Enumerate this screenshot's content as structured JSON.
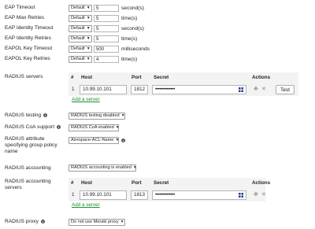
{
  "eap": {
    "rows": [
      {
        "label": "EAP Timeout",
        "mode": "Default",
        "value": "5",
        "unit": "second(s)"
      },
      {
        "label": "EAP Max Retries",
        "mode": "Default",
        "value": "5",
        "unit": "time(s)"
      },
      {
        "label": "EAP Identity Timeout",
        "mode": "Default",
        "value": "5",
        "unit": "second(s)"
      },
      {
        "label": "EAP Identity Retries",
        "mode": "Default",
        "value": "5",
        "unit": "time(s)"
      },
      {
        "label": "EAPOL Key Timeout",
        "mode": "Default",
        "value": "500",
        "unit": "milliseconds"
      },
      {
        "label": "EAPOL Key Retries",
        "mode": "Default",
        "value": "4",
        "unit": "time(s)"
      }
    ]
  },
  "radius_servers": {
    "label": "RADIUS servers",
    "headers": {
      "num": "#",
      "host": "Host",
      "port": "Port",
      "secret": "Secret",
      "actions": "Actions"
    },
    "row": {
      "index": "1",
      "host": "10.99.10.101",
      "port": "1812",
      "secret": "••••••••••••••"
    },
    "test_label": "Test",
    "add_label": "Add a server"
  },
  "radius_testing": {
    "label": "RADIUS testing",
    "value": "RADIUS testing disabled"
  },
  "radius_coa": {
    "label": "RADIUS CoA support",
    "value": "RADIUS CoA enabled"
  },
  "radius_group_policy": {
    "label_lines": [
      "RADIUS attribute",
      "specifying group policy",
      "name"
    ],
    "value": "Airespace-ACL-Name"
  },
  "radius_accounting": {
    "label": "RADIUS accounting",
    "value": "RADIUS accounting is enabled"
  },
  "radius_accounting_servers": {
    "label_lines": [
      "RADIUS accounting",
      "servers"
    ],
    "headers": {
      "num": "#",
      "host": "Host",
      "port": "Port",
      "secret": "Secret",
      "actions": "Actions"
    },
    "row": {
      "index": "1",
      "host": "10.99.10.101",
      "port": "1813",
      "secret": "••••••••••••••"
    },
    "add_label": "Add a server"
  },
  "radius_proxy": {
    "label": "RADIUS proxy",
    "value": "Do not use Meraki proxy"
  }
}
